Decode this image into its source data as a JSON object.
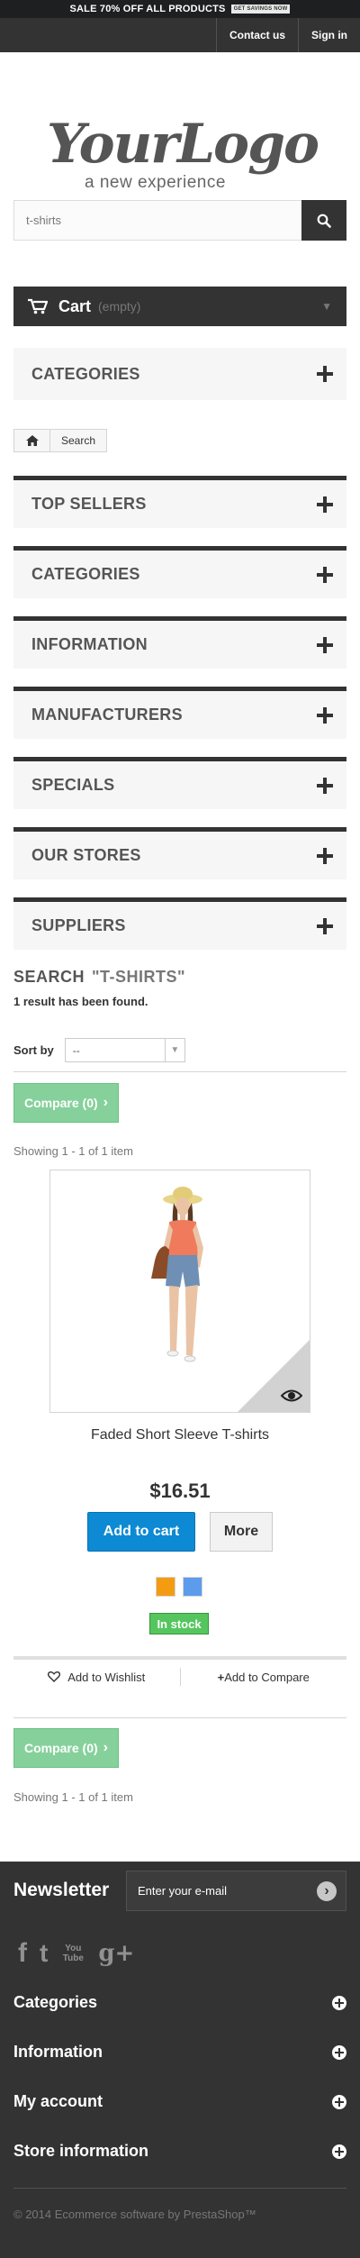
{
  "banner": {
    "text": "SALE 70% OFF ALL PRODUCTS",
    "button": "GET SAVINGS NOW"
  },
  "header": {
    "contact": "Contact us",
    "signin": "Sign in"
  },
  "logo": {
    "main": "YourLogo",
    "sub": "a new experience"
  },
  "search": {
    "value": "t-shirts"
  },
  "cart": {
    "title": "Cart",
    "status": "(empty)"
  },
  "categories_block": {
    "title": "CATEGORIES"
  },
  "breadcrumb": {
    "current": "Search"
  },
  "blocks": [
    {
      "title": "TOP SELLERS"
    },
    {
      "title": "CATEGORIES"
    },
    {
      "title": "INFORMATION"
    },
    {
      "title": "MANUFACTURERS"
    },
    {
      "title": "SPECIALS"
    },
    {
      "title": "OUR STORES"
    },
    {
      "title": "SUPPLIERS"
    }
  ],
  "results": {
    "heading": "SEARCH",
    "query": "\"T-SHIRTS\"",
    "count": "1 result has been found.",
    "sort_label": "Sort by",
    "sort_value": "--",
    "compare_label": "Compare (0)",
    "showing": "Showing 1 - 1 of 1 item"
  },
  "product": {
    "name": "Faded Short Sleeve T-shirts",
    "price": "$16.51",
    "add_to_cart": "Add to cart",
    "more": "More",
    "colors": [
      "#f39c11",
      "#5d9cec"
    ],
    "availability": "In stock",
    "wishlist": "Add to Wishlist",
    "compare": "Add to Compare"
  },
  "footer": {
    "newsletter_title": "Newsletter",
    "newsletter_placeholder": "Enter your e-mail",
    "social": [
      "f",
      "t",
      "You Tube",
      "g+"
    ],
    "sections": [
      "Categories",
      "Information",
      "My account",
      "Store information"
    ],
    "copyright": "© 2014 Ecommerce software by PrestaShop™"
  }
}
